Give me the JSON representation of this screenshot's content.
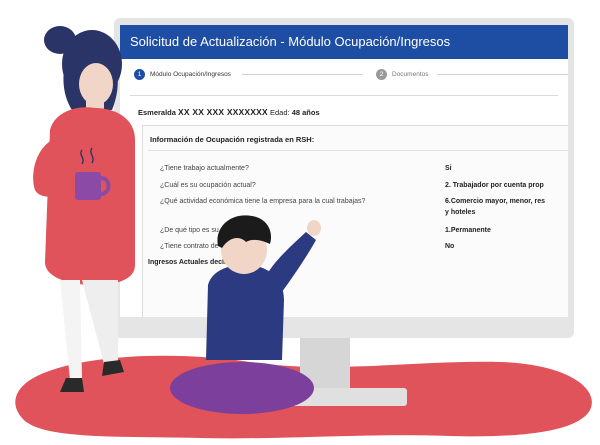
{
  "app": {
    "title": "Solicitud de Actualización - Módulo Ocupación/Ingresos"
  },
  "stepper": {
    "steps": [
      {
        "number": "1",
        "label": "Módulo Ocupación/Ingresos"
      },
      {
        "number": "2",
        "label": "Documentos"
      }
    ]
  },
  "person": {
    "first_name": "Esmeralda",
    "masked_name": "XX XX XXX XXXXXXX",
    "age_label": "Edad:",
    "age_value": "48 años"
  },
  "panel": {
    "title": "Información de Ocupación registrada en RSH:",
    "rows": [
      {
        "question": "¿Tiene trabajo actualmente?",
        "answer": "Si"
      },
      {
        "question": "¿Cuál es su ocupación actual?",
        "answer": "2. Trabajador por cuenta prop"
      },
      {
        "question": "¿Qué actividad económica tiene la empresa para la cual trabajas?",
        "answer": "6.Comercio mayor, menor, res",
        "answer_line2": "y hoteles"
      },
      {
        "question": "¿De qué tipo es su trab",
        "answer": "1.Permanente"
      },
      {
        "question": "¿Tiene contrato de tra",
        "answer": "No"
      }
    ],
    "income_title": "Ingresos Actuales declarad"
  },
  "colors": {
    "header_blue": "#1d4ea3",
    "rug_red": "#e0535a",
    "woman_sweater": "#e0535a",
    "woman_hair": "#2a3467",
    "mug_purple": "#8b4aa6",
    "boy_sweater": "#2c3a82",
    "boy_pants": "#7d3f9c"
  }
}
